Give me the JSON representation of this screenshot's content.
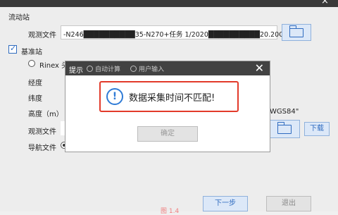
{
  "top_close": "×",
  "rover": {
    "section_title": "流动站",
    "obs_label": "观测文件",
    "obs_value": "-N246██████████35-N270+任务 1/2020██████████20.20O"
  },
  "base": {
    "section_title": "基准站",
    "rinex_label": "Rinex 头",
    "lon_label": "经度",
    "lat_label": "纬度",
    "height_label": "高度（m）",
    "coord_value": "WGS84\"",
    "obs_label": "观测文件",
    "nav_label": "导航文件",
    "download_label": "下载"
  },
  "footer": {
    "next_label": "下一步",
    "exit_label": "退出"
  },
  "dialog": {
    "title": "提示",
    "close": "✕",
    "ghost_auto": "自动计算",
    "ghost_manual": "用户输入",
    "alert_icon": "!",
    "message": "数据采集时间不匹配!",
    "ok_label": "确定"
  },
  "caption": "图 1.4"
}
